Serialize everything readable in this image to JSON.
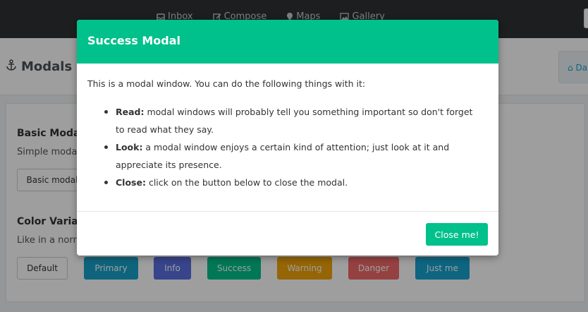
{
  "topnav": {
    "items": [
      {
        "label": "Inbox",
        "icon": "inbox-icon"
      },
      {
        "label": "Compose",
        "icon": "edit-icon"
      },
      {
        "label": "Maps",
        "icon": "map-marker-icon"
      },
      {
        "label": "Gallery",
        "icon": "image-icon"
      }
    ]
  },
  "header": {
    "title": "Modals",
    "dash_label": "Da"
  },
  "content": {
    "basic": {
      "title": "Basic Modals",
      "text": "Simple modal",
      "button": "Basic modal"
    },
    "color": {
      "title": "Color Variatio",
      "text": "Like in a norma",
      "buttons": [
        {
          "label": "Default",
          "color": "#ffffff"
        },
        {
          "label": "Primary",
          "color": "#17a2c9"
        },
        {
          "label": "Info",
          "color": "#5b6ee1"
        },
        {
          "label": "Success",
          "color": "#00c08b"
        },
        {
          "label": "Warning",
          "color": "#f0a30a"
        },
        {
          "label": "Danger",
          "color": "#f06a6a"
        },
        {
          "label": "Just me",
          "color": "#15a3cf"
        }
      ]
    }
  },
  "modal": {
    "title": "Success Modal",
    "accent": "#00c08b",
    "intro": "This is a modal window. You can do the following things with it:",
    "items": [
      {
        "term": "Read:",
        "text": " modal windows will probably tell you something important so don't forget to read what they say."
      },
      {
        "term": "Look:",
        "text": " a modal window enjoys a certain kind of attention; just look at it and appreciate its presence."
      },
      {
        "term": "Close:",
        "text": " click on the button below to close the modal."
      }
    ],
    "close_label": "Close me!"
  }
}
